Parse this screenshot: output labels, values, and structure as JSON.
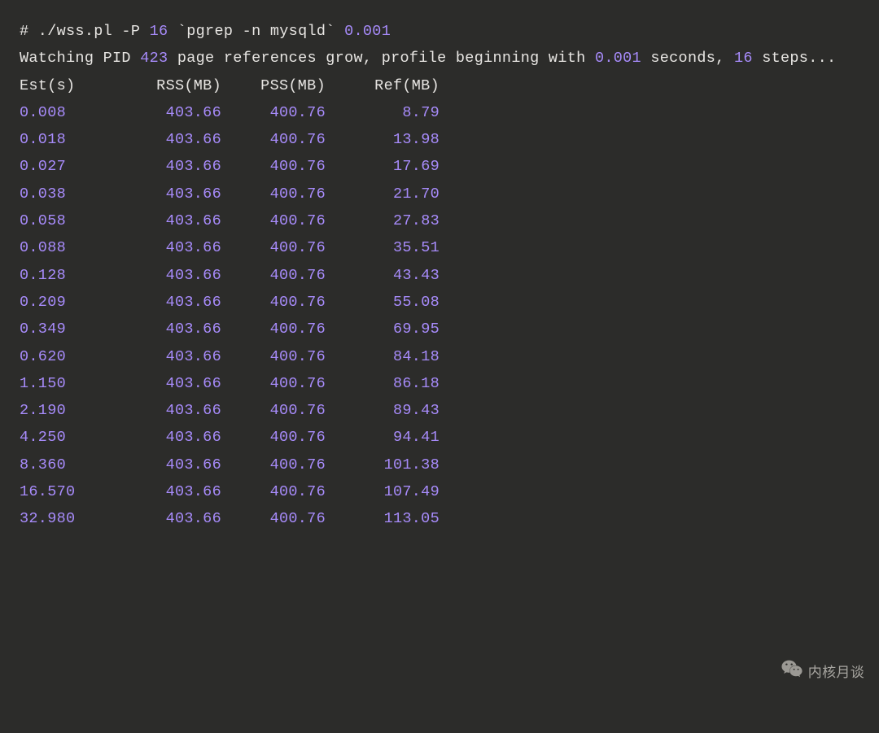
{
  "cmd": {
    "prefix": "# ./wss.pl -P ",
    "steps": "16",
    "mid": " `pgrep -n mysqld` ",
    "interval": "0.001"
  },
  "status": {
    "s1": "Watching PID ",
    "pid": "423",
    "s2": " page references grow, profile beginning with ",
    "interval": "0.001",
    "s3": " seconds, ",
    "steps": "16",
    "s4": " steps..."
  },
  "cols": {
    "c1": "Est(s)",
    "c2": "RSS(MB)",
    "c3": "PSS(MB)",
    "c4": "Ref(MB)"
  },
  "rows": [
    {
      "est": "0.008",
      "rss": "403.66",
      "pss": "400.76",
      "ref": "8.79"
    },
    {
      "est": "0.018",
      "rss": "403.66",
      "pss": "400.76",
      "ref": "13.98"
    },
    {
      "est": "0.027",
      "rss": "403.66",
      "pss": "400.76",
      "ref": "17.69"
    },
    {
      "est": "0.038",
      "rss": "403.66",
      "pss": "400.76",
      "ref": "21.70"
    },
    {
      "est": "0.058",
      "rss": "403.66",
      "pss": "400.76",
      "ref": "27.83"
    },
    {
      "est": "0.088",
      "rss": "403.66",
      "pss": "400.76",
      "ref": "35.51"
    },
    {
      "est": "0.128",
      "rss": "403.66",
      "pss": "400.76",
      "ref": "43.43"
    },
    {
      "est": "0.209",
      "rss": "403.66",
      "pss": "400.76",
      "ref": "55.08"
    },
    {
      "est": "0.349",
      "rss": "403.66",
      "pss": "400.76",
      "ref": "69.95"
    },
    {
      "est": "0.620",
      "rss": "403.66",
      "pss": "400.76",
      "ref": "84.18"
    },
    {
      "est": "1.150",
      "rss": "403.66",
      "pss": "400.76",
      "ref": "86.18"
    },
    {
      "est": "2.190",
      "rss": "403.66",
      "pss": "400.76",
      "ref": "89.43"
    },
    {
      "est": "4.250",
      "rss": "403.66",
      "pss": "400.76",
      "ref": "94.41"
    },
    {
      "est": "8.360",
      "rss": "403.66",
      "pss": "400.76",
      "ref": "101.38"
    },
    {
      "est": "16.570",
      "rss": "403.66",
      "pss": "400.76",
      "ref": "107.49"
    },
    {
      "est": "32.980",
      "rss": "403.66",
      "pss": "400.76",
      "ref": "113.05"
    }
  ],
  "watermark": "内核月谈"
}
